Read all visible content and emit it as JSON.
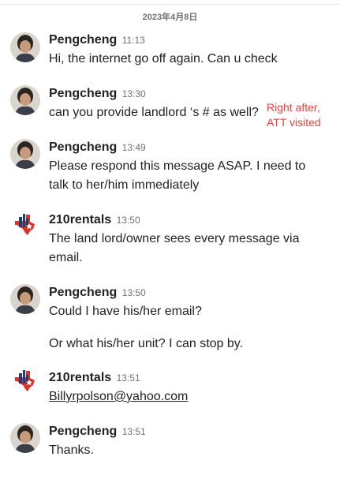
{
  "date_header": "2023年4月8日",
  "messages": [
    {
      "sender": "Pengcheng",
      "time": "11:13",
      "lines": [
        "Hi, the internet go off again. Can u check"
      ]
    },
    {
      "sender": "Pengcheng",
      "time": "13:30",
      "lines": [
        "can you provide landlord ‘s # as well?"
      ],
      "annotation": [
        "Right after,",
        "ATT visited"
      ]
    },
    {
      "sender": "Pengcheng",
      "time": "13:49",
      "lines": [
        "Please respond this message ASAP. I need to",
        "talk to her/him immediately"
      ]
    },
    {
      "sender": "210rentals",
      "time": "13:50",
      "lines": [
        "The land lord/owner sees every message via",
        "email."
      ]
    },
    {
      "sender": "Pengcheng",
      "time": "13:50",
      "lines": [
        "Could I have his/her email?",
        "Or what his/her unit? I can stop by."
      ]
    },
    {
      "sender": "210rentals",
      "time": "13:51",
      "lines": [
        "Billyrpolson@yahoo.com"
      ]
    },
    {
      "sender": "Pengcheng",
      "time": "13:51",
      "lines": [
        "Thanks."
      ]
    }
  ],
  "colors": {
    "annotation": "#e8403a",
    "text": "#222222",
    "muted": "#717171",
    "texas_blue": "#1f3f73",
    "texas_red": "#d9342b"
  }
}
